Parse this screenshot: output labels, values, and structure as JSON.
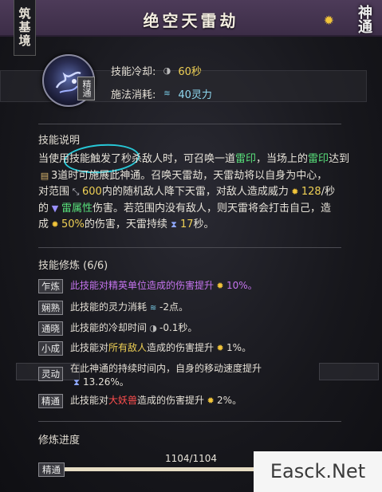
{
  "header": {
    "realm": "筑基境",
    "title": "绝空天雷劫",
    "corner_badge": "神通"
  },
  "skill": {
    "tier": "精通",
    "cooldown_label": "技能冷却:",
    "cooldown_value": "60秒",
    "cost_label": "施法消耗:",
    "cost_value": "40灵力"
  },
  "description": {
    "title": "技能说明",
    "p1": "当使用技能触发了秒杀敌人时，可召唤一道",
    "p1_hl": "雷印",
    "p2": "，当场上的",
    "p2_hl": "雷印",
    "p3": "达到",
    "p4": "3道时可施展此神通。召唤天雷劫，天雷劫将以自身为中心，",
    "p5": "对范围",
    "p5_num": "600",
    "p6": "内的随机敌人降下天雷，对敌人造成威力",
    "p6_num": "128",
    "p7": "/秒",
    "p8": "的",
    "p8_hl": "雷属性",
    "p9": "伤害。若范围内没有敌人，则天雷将会打击自己，造",
    "p10": "成",
    "p10_num": "50%",
    "p11": "的伤害，天雷持续",
    "p11_num": "17",
    "p12": "秒。"
  },
  "refine": {
    "title": "技能修炼 (6/6)",
    "items": [
      {
        "tag": "乍炼",
        "text": "此技能对精英单位造成的伤害提升",
        "value": "10%。"
      },
      {
        "tag": "娴熟",
        "text": "此技能的灵力消耗",
        "value": "-2点。"
      },
      {
        "tag": "通晓",
        "text": "此技能的冷却时间",
        "value": "-0.1秒。"
      },
      {
        "tag": "小成",
        "text_a": "此技能对",
        "hl": "所有敌人",
        "text_b": "造成的伤害提升",
        "value": "1%。"
      },
      {
        "tag": "灵动",
        "line1": "在此神通的持续时间内，自身的移动速度提升",
        "value": "13.26%。"
      },
      {
        "tag": "精通",
        "text_a": "此技能对",
        "hl": "大妖兽",
        "text_b": "造成的伤害提升",
        "value": "2%。"
      }
    ]
  },
  "progress": {
    "title": "修炼进度",
    "value_text": "1104/1104",
    "tag": "精通",
    "fraction": 1.0
  },
  "watermark": "Easck.Net",
  "colors": {
    "header_bg": "#4d3b59",
    "highlight_green": "#58e07a",
    "highlight_yellow": "#efd055",
    "highlight_purple": "#c574ee",
    "highlight_red": "#ff4e4e",
    "circle_annotation": "#27c7d6"
  }
}
